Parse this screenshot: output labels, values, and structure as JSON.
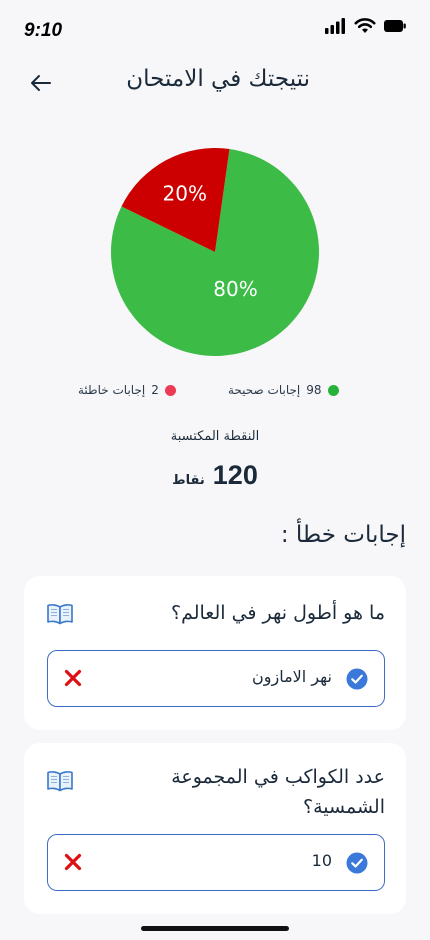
{
  "status": {
    "time": "9:10",
    "icons": [
      "signal-icon",
      "wifi-icon",
      "battery-icon"
    ]
  },
  "header": {
    "title": "نتيجتك في الامتحان",
    "back_icon": "arrow-left-icon"
  },
  "chart_data": {
    "type": "pie",
    "categories": [
      "إجابات صحيحة",
      "إجابات خاطئة"
    ],
    "values": [
      80,
      20
    ],
    "labels": [
      "80%",
      "20%"
    ],
    "colors": [
      "#3cbc46",
      "#cc0000"
    ]
  },
  "legend": {
    "correct": {
      "count": "98",
      "label": "إجابات صحيحة",
      "color": "#27b33a"
    },
    "wrong": {
      "count": "2",
      "label": "إجابات خاطئة",
      "color": "#ee3b54"
    }
  },
  "score": {
    "label": "النقطة المكتسبة",
    "value": "120",
    "unit": "نقاط"
  },
  "wrong_answers": {
    "title": "إجابات خطأ :",
    "items": [
      {
        "question": "ما هو أطول نهر في العالم؟",
        "answer": "نهر الامازون",
        "icon": "book-icon"
      },
      {
        "question": "عدد الكواكب في المجموعة الشمسية؟",
        "answer": "10",
        "icon": "book-icon"
      }
    ]
  },
  "colors": {
    "accent": "#3d6ec7",
    "check": "#3a78d9",
    "wrong_mark": "#dd1111"
  }
}
